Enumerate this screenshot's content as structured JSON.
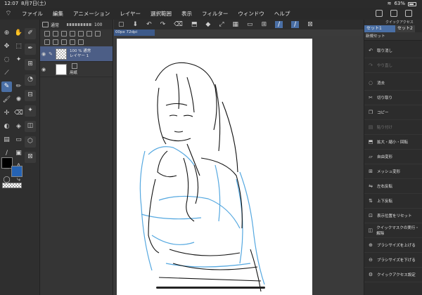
{
  "status": {
    "time": "12:07",
    "date": "8月7日(土)",
    "battery": "63%"
  },
  "menu": [
    "ファイル",
    "編集",
    "アニメーション",
    "レイヤー",
    "選択範囲",
    "表示",
    "フィルター",
    "ウィンドウ",
    "ヘルプ"
  ],
  "tool_panel_title": "ツール",
  "layer_panel": {
    "blend_mode": "通常",
    "opacity": "100",
    "layers": [
      {
        "line1": "100 % 通常",
        "line2": "レイヤー 1"
      },
      {
        "line1": "",
        "line2": "用紙"
      }
    ]
  },
  "canvas": {
    "tab_label": "00px 72dpi (112.5%)"
  },
  "quick_access": {
    "title": "クイックアクセス",
    "tabs": [
      "セット1",
      "セット2"
    ],
    "set_label": "新規セット",
    "items": [
      {
        "label": "取り消し",
        "icon": "undo-icon",
        "enabled": true
      },
      {
        "label": "やり直し",
        "icon": "redo-icon",
        "enabled": false
      },
      {
        "label": "消去",
        "icon": "clear-icon",
        "enabled": true
      },
      {
        "label": "切り取り",
        "icon": "cut-icon",
        "enabled": true
      },
      {
        "label": "コピー",
        "icon": "copy-icon",
        "enabled": true
      },
      {
        "label": "貼り付け",
        "icon": "paste-icon",
        "enabled": false
      },
      {
        "label": "拡大・縮小・回転",
        "icon": "transform-icon",
        "enabled": true
      },
      {
        "label": "自由変形",
        "icon": "free-transform-icon",
        "enabled": true
      },
      {
        "label": "メッシュ変形",
        "icon": "mesh-icon",
        "enabled": true
      },
      {
        "label": "左右反転",
        "icon": "flip-h-icon",
        "enabled": true
      },
      {
        "label": "上下反転",
        "icon": "flip-v-icon",
        "enabled": true
      },
      {
        "label": "表示位置をリセット",
        "icon": "reset-view-icon",
        "enabled": true
      },
      {
        "label": "クイックマスクの実行・解除",
        "icon": "quick-mask-icon",
        "enabled": true
      },
      {
        "label": "ブラシサイズを上げる",
        "icon": "brush-up-icon",
        "enabled": true
      },
      {
        "label": "ブラシサイズを下げる",
        "icon": "brush-down-icon",
        "enabled": true
      },
      {
        "label": "クイックアクセス設定",
        "icon": "settings-icon",
        "enabled": true
      }
    ]
  },
  "colors": {
    "accent": "#4a6fa5",
    "main_color": "#000000",
    "sub_color": "#2563b4"
  }
}
